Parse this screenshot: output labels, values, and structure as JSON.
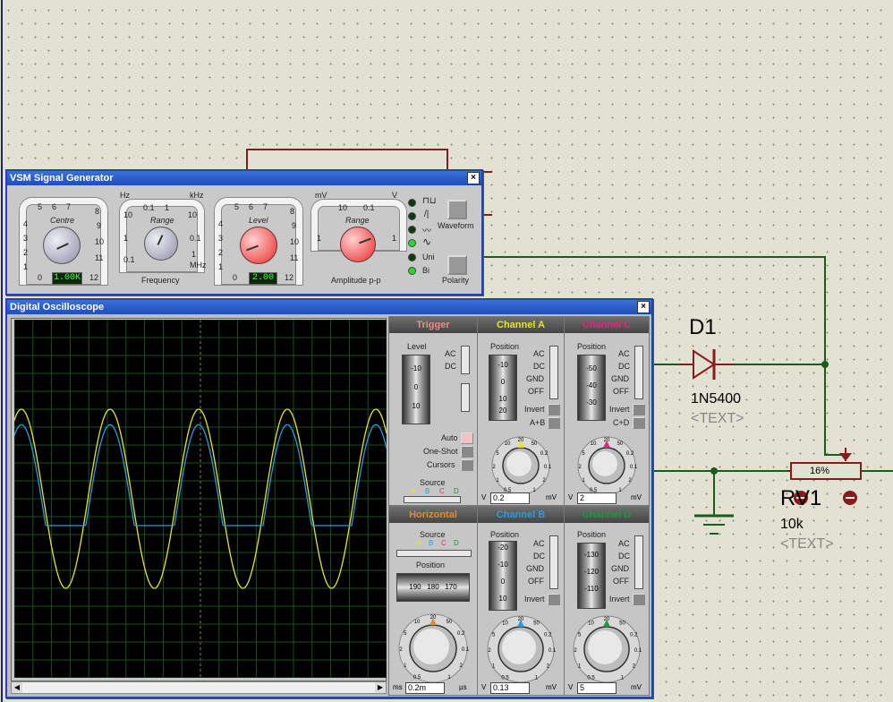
{
  "signal_generator": {
    "title": "VSM Signal Generator",
    "close": "×",
    "centre": {
      "label": "Centre",
      "scale": [
        "5",
        "6",
        "7",
        "8",
        "4",
        "9",
        "3",
        "10",
        "2",
        "11",
        "1",
        "12",
        "0"
      ],
      "value": "1.00K"
    },
    "range_freq": {
      "label": "Range",
      "unit_top_left": "Hz",
      "unit_top_right": "kHz",
      "unit_bottom_right": "MHz",
      "scale": [
        "0.1",
        "1",
        "10",
        "1",
        "10",
        "0.1",
        "1",
        "0.1"
      ]
    },
    "frequency_label": "Frequency",
    "level": {
      "label": "Level",
      "scale": [
        "5",
        "6",
        "7",
        "8",
        "4",
        "9",
        "3",
        "10",
        "2",
        "11",
        "1",
        "12",
        "0"
      ],
      "value": "2.00"
    },
    "range_amp": {
      "label": "Range",
      "unit_left": "mV",
      "unit_right": "V",
      "scale": [
        "10",
        "0.1",
        "1",
        "1"
      ]
    },
    "amplitude_label": "Amplitude p-p",
    "waveform_label": "Waveform",
    "uni_label": "Uni",
    "bi_label": "Bi",
    "polarity_label": "Polarity",
    "wave_symbols": [
      "⊓⊔",
      "/|",
      "〰",
      "∿"
    ]
  },
  "oscilloscope": {
    "title": "Digital Oscilloscope",
    "close": "×",
    "trigger": {
      "title": "Trigger",
      "level_label": "Level",
      "drum_values": [
        "-10",
        "0",
        "10"
      ],
      "ac": "AC",
      "dc": "DC",
      "auto": "Auto",
      "one_shot": "One-Shot",
      "cursors": "Cursors",
      "source_label": "Source",
      "sources": [
        "A",
        "B",
        "C",
        "D"
      ]
    },
    "channel_a": {
      "title": "Channel A",
      "position_label": "Position",
      "drum_values": [
        "-10",
        "0",
        "10",
        "20"
      ],
      "ac": "AC",
      "dc": "DC",
      "gnd": "GND",
      "off": "OFF",
      "invert": "Invert",
      "combine": "A+B",
      "value": "0.2",
      "unit": "mV",
      "unit_left": "V"
    },
    "channel_c": {
      "title": "Channel C",
      "position_label": "Position",
      "drum_values": [
        "-50",
        "-40",
        "-30"
      ],
      "ac": "AC",
      "dc": "DC",
      "gnd": "GND",
      "off": "OFF",
      "invert": "Invert",
      "combine": "C+D",
      "value": "2",
      "unit": "mV",
      "unit_left": "V"
    },
    "horizontal": {
      "title": "Horizontal",
      "source_label": "Source",
      "sources": [
        "A",
        "B",
        "C",
        "D"
      ],
      "position_label": "Position",
      "drum_values": [
        "190",
        "180",
        "170"
      ],
      "value": "0.2m",
      "unit": "µs",
      "unit_left": "ms"
    },
    "channel_b": {
      "title": "Channel B",
      "position_label": "Position",
      "drum_values": [
        "-20",
        "-10",
        "0",
        "10"
      ],
      "ac": "AC",
      "dc": "DC",
      "gnd": "GND",
      "off": "OFF",
      "invert": "Invert",
      "value": "0.13",
      "unit": "mV",
      "unit_left": "V"
    },
    "channel_d": {
      "title": "Channel D",
      "position_label": "Position",
      "drum_values": [
        "-130",
        "-120",
        "-110"
      ],
      "ac": "AC",
      "dc": "DC",
      "gnd": "GND",
      "off": "OFF",
      "invert": "Invert",
      "value": "5",
      "unit": "mV",
      "unit_left": "V"
    },
    "dial_scale": [
      "0.5",
      "1",
      "2",
      "5",
      "10",
      "20",
      "50",
      "0.2",
      "0.1",
      "2",
      "1"
    ],
    "colors": {
      "a": "#e6e61a",
      "b": "#2c9adf",
      "c": "#e0257d",
      "d": "#1a9a3c",
      "trigger": "#e88a8a",
      "horizontal": "#e08a3a"
    },
    "scrollbar": {
      "left": "◀",
      "right": "▶"
    }
  },
  "schematic": {
    "diode_ref": "D1",
    "diode_value": "1N5400",
    "diode_text": "<TEXT>",
    "pot_ref": "RV1",
    "pot_value": "10k",
    "pot_text": "<TEXT>",
    "pot_percent": "16%",
    "wire_color": "#1a5c1a",
    "component_color": "#8b1a1a"
  }
}
